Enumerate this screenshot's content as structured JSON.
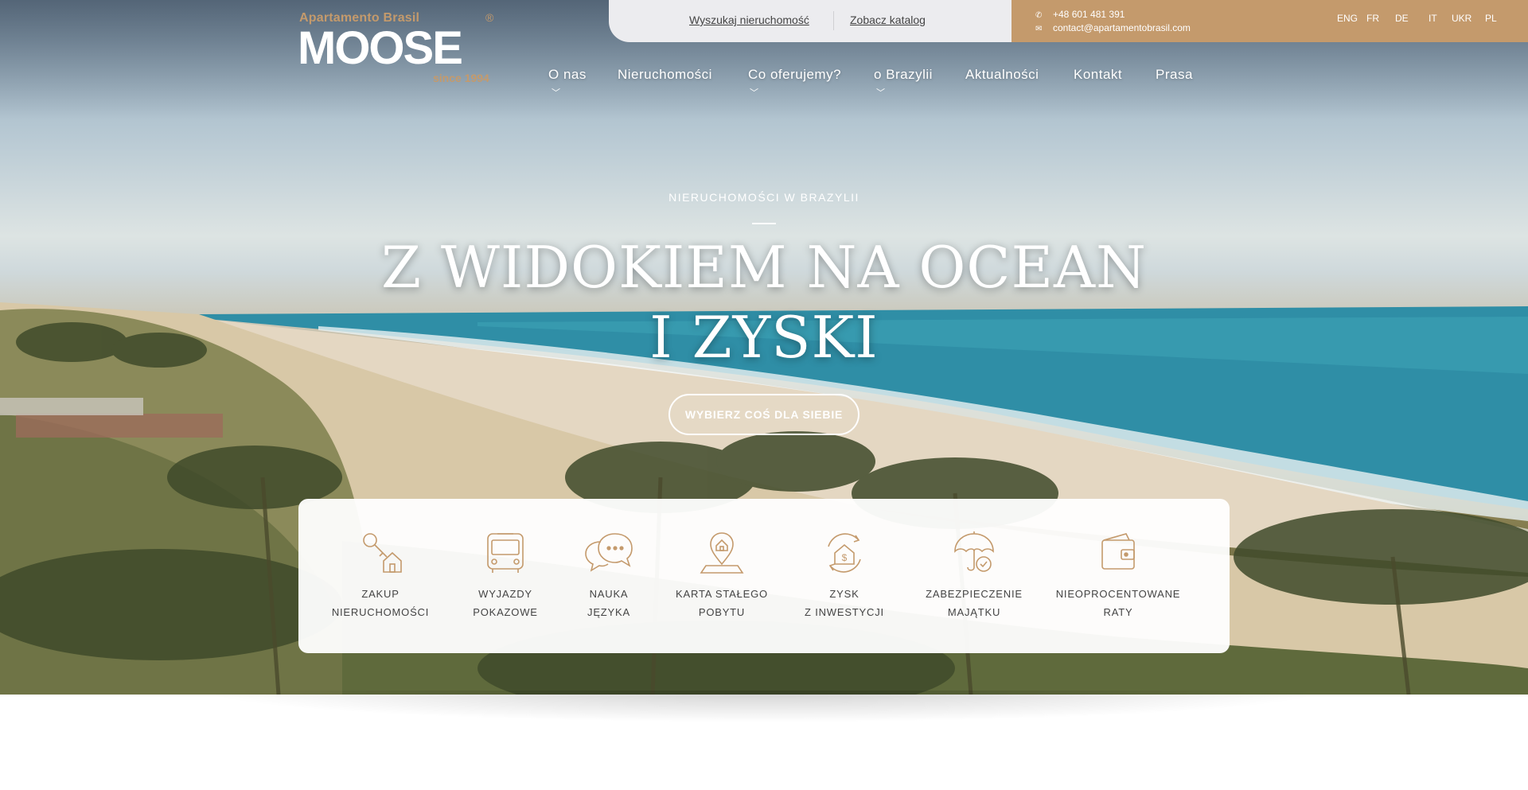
{
  "logo": {
    "brand": "Apartamento Brasil",
    "name": "MOOSE",
    "since": "since 1994",
    "reg": "®"
  },
  "topbar": {
    "search_link": "Wyszukaj nieruchomość",
    "catalog_link": "Zobacz katalog",
    "phone": "+48 601 481 391",
    "email": "contact@apartamentobrasil.com",
    "phone_icon": "phone-icon",
    "email_icon": "envelope-icon"
  },
  "languages": [
    "ENG",
    "FR",
    "DE",
    "IT",
    "UKR",
    "PL"
  ],
  "nav": [
    {
      "label": "O nas",
      "dropdown": true
    },
    {
      "label": "Nieruchomości",
      "dropdown": false
    },
    {
      "label": "Co oferujemy?",
      "dropdown": true
    },
    {
      "label": "o Brazylii",
      "dropdown": true
    },
    {
      "label": "Aktualności",
      "dropdown": false
    },
    {
      "label": "Kontakt",
      "dropdown": false
    },
    {
      "label": "Prasa",
      "dropdown": false
    }
  ],
  "hero": {
    "kicker": "NIERUCHOMOŚCI W BRAZYLII",
    "title_line1": "Z WIDOKIEM NA OCEAN",
    "title_line2": "I ZYSKI",
    "cta": "WYBIERZ COŚ DLA SIEBIE"
  },
  "services": [
    {
      "icon": "house-key-icon",
      "label": "ZAKUP\nNIERUCHOMOŚCI"
    },
    {
      "icon": "bus-icon",
      "label": "WYJAZDY\nPOKAZOWE"
    },
    {
      "icon": "chat-bubbles-icon",
      "label": "NAUKA\nJĘZYKA"
    },
    {
      "icon": "map-pin-house-icon",
      "label": "KARTA STAŁEGO\nPOBYTU"
    },
    {
      "icon": "house-dollar-icon",
      "label": "ZYSK\nZ INWESTYCJI"
    },
    {
      "icon": "umbrella-check-icon",
      "label": "ZABEZPIECZENIE\nMAJĄTKU"
    },
    {
      "icon": "wallet-icon",
      "label": "NIEOPROCENTOWANE\nRATY"
    }
  ],
  "colors": {
    "accent": "#c49a6c",
    "topbar_light": "#ececef",
    "text_dark": "#444444",
    "white": "#ffffff"
  }
}
